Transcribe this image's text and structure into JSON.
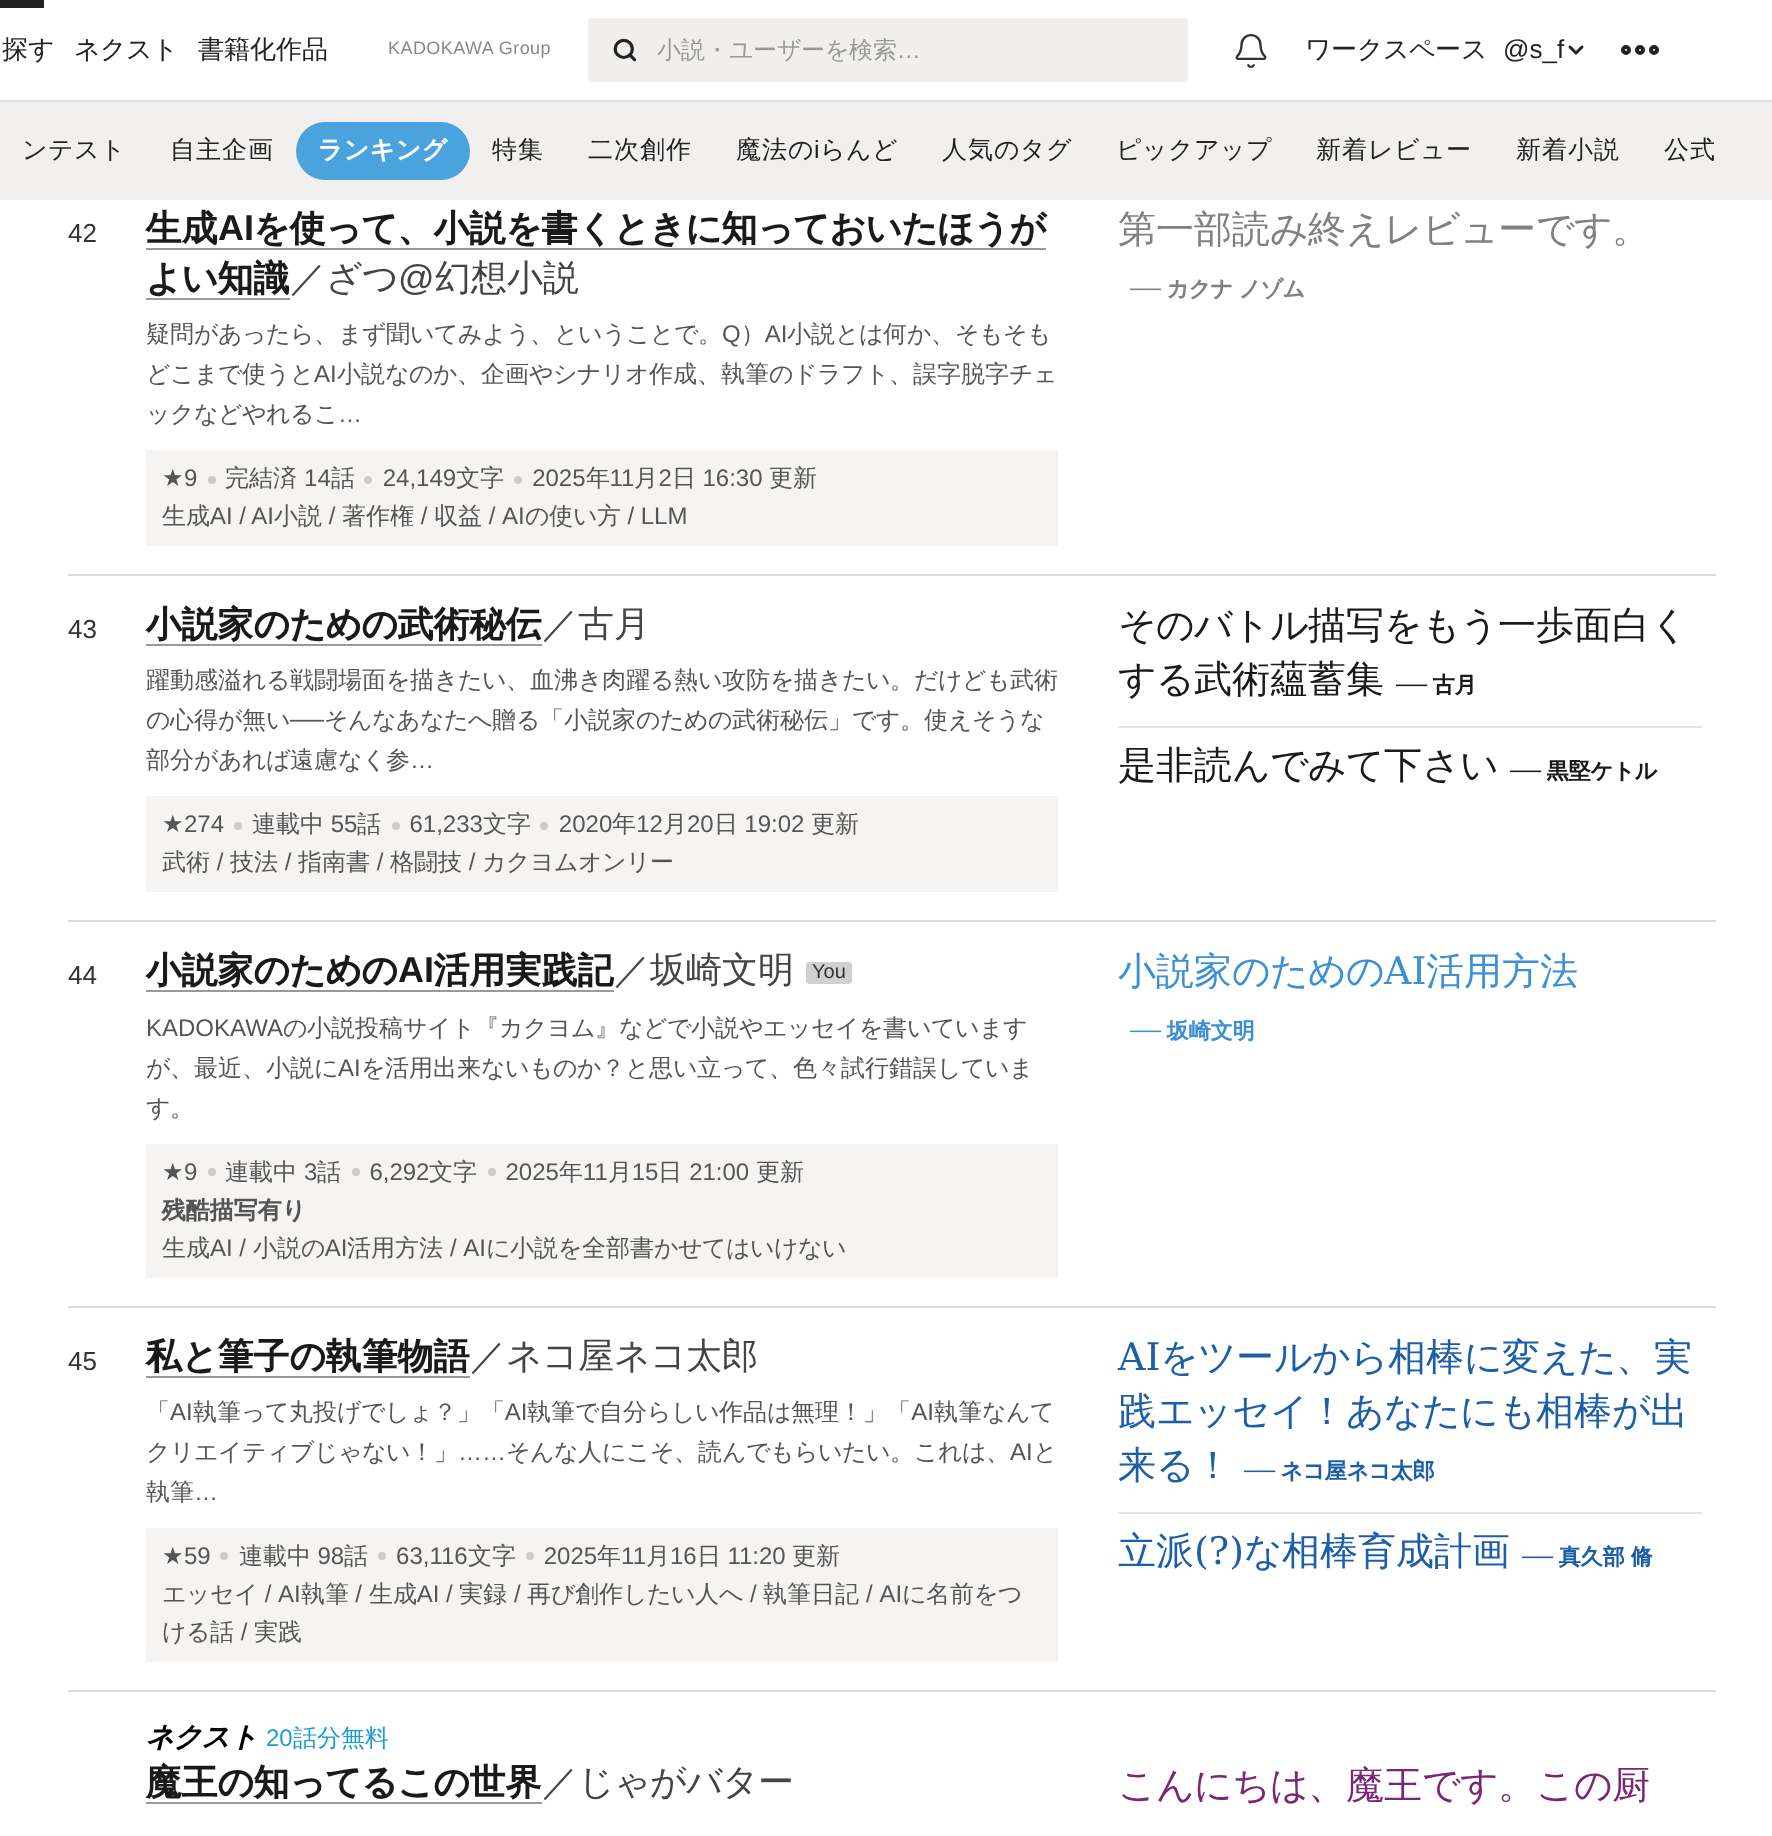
{
  "header": {
    "nav_links": [
      "探す",
      "ネクスト",
      "書籍化作品"
    ],
    "group_label": "KADOKAWA Group",
    "search": {
      "placeholder": "小説・ユーザーを検索…"
    },
    "workspace": "ワークスペース",
    "user": "@s_f"
  },
  "category_tabs": [
    {
      "label": "ンテスト",
      "selected": false
    },
    {
      "label": "自主企画",
      "selected": false
    },
    {
      "label": "ランキング",
      "selected": true
    },
    {
      "label": "特集",
      "selected": false
    },
    {
      "label": "二次創作",
      "selected": false
    },
    {
      "label": "魔法のiらんど",
      "selected": false
    },
    {
      "label": "人気のタグ",
      "selected": false
    },
    {
      "label": "ピックアップ",
      "selected": false
    },
    {
      "label": "新着レビュー",
      "selected": false
    },
    {
      "label": "新着小説",
      "selected": false
    },
    {
      "label": "公式",
      "selected": false
    }
  ],
  "works": [
    {
      "rank": "42",
      "title": "生成AIを使って、小説を書くときに知っておいたほうがよい知識",
      "author": "／ざつ@幻想小説",
      "description": "疑問があったら、まず聞いてみよう、ということで。Q）AI小説とは何か、そもそもどこまで使うとAI小説なのか、企画やシナリオ作成、執筆のドラフト、誤字脱字チェックなどやれるこ…",
      "meta": [
        "★9",
        "完結済 14話",
        "24,149文字",
        "2025年11月2日 16:30 更新"
      ],
      "tags": "生成AI / AI小説 / 著作権 / 収益 / AIの使い方 / LLM",
      "reviews": [
        {
          "text": "第一部読み終えレビューです。",
          "author": "── カクナ ノゾム",
          "color": "#808080"
        }
      ]
    },
    {
      "rank": "43",
      "title": "小説家のための武術秘伝",
      "author": "／古月",
      "description": "躍動感溢れる戦闘場面を描きたい、血沸き肉躍る熱い攻防を描きたい。だけども武術の心得が無い──そんなあなたへ贈る「小説家のための武術秘伝」です。使えそうな部分があれば遠慮なく参…",
      "meta": [
        "★274",
        "連載中 55話",
        "61,233文字",
        "2020年12月20日 19:02 更新"
      ],
      "tags": "武術 / 技法 / 指南書 / 格闘技 / カクヨムオンリー",
      "reviews": [
        {
          "text": "そのバトル描写をもう一歩面白くする武術蘊蓄集",
          "author": "── 古月",
          "color": "#1a1a1a"
        },
        {
          "text": "是非読んでみて下さい",
          "author": "── 黒堅ケトル",
          "color": "#1a1a1a"
        }
      ]
    },
    {
      "rank": "44",
      "title": "小説家のためのAI活用実践記",
      "author": "／坂崎文明",
      "you_label": "You",
      "description": "KADOKAWAの小説投稿サイト『カクヨム』などで小説やエッセイを書いていますが、最近、小説にAIを活用出来ないものか？と思い立って、色々試行錯誤しています。",
      "meta": [
        "★9",
        "連載中 3話",
        "6,292文字",
        "2025年11月15日 21:00 更新"
      ],
      "warning": "残酷描写有り",
      "tags": "生成AI / 小説のAI活用方法 / AIに小説を全部書かせてはいけない",
      "reviews": [
        {
          "text": "小説家のためのAI活用方法",
          "author": "── 坂崎文明",
          "color": "#3b8fd6"
        }
      ]
    },
    {
      "rank": "45",
      "title": "私と筆子の執筆物語",
      "author": "／ネコ屋ネコ太郎",
      "description": "「AI執筆って丸投げでしょ？」「AI執筆で自分らしい作品は無理！」「AI執筆なんてクリエイティブじゃない！」……そんな人にこそ、読んでもらいたい。これは、AIと執筆…",
      "meta": [
        "★59",
        "連載中 98話",
        "63,116文字",
        "2025年11月16日 11:20 更新"
      ],
      "tags": "エッセイ / AI執筆 / 生成AI / 実録 / 再び創作したい人へ / 執筆日記 / AIに名前をつける話 / 実践",
      "reviews": [
        {
          "text": "AIをツールから相棒に変えた、実践エッセイ！あなたにも相棒が出来る！",
          "author": "── ネコ屋ネコ太郎",
          "color": "#1d5ea8"
        },
        {
          "text": "立派(?)な相棒育成計画",
          "author": "── 真久部 脩",
          "color": "#1d5ea8"
        }
      ]
    },
    {
      "next_label": "ネクスト",
      "free_label": "20話分無料",
      "title": "魔王の知ってるこの世界",
      "author": "／じゃがバター",
      "reviews": [
        {
          "text": "こんにちは、魔王です。この厨",
          "color": "#7b2577"
        }
      ]
    }
  ]
}
